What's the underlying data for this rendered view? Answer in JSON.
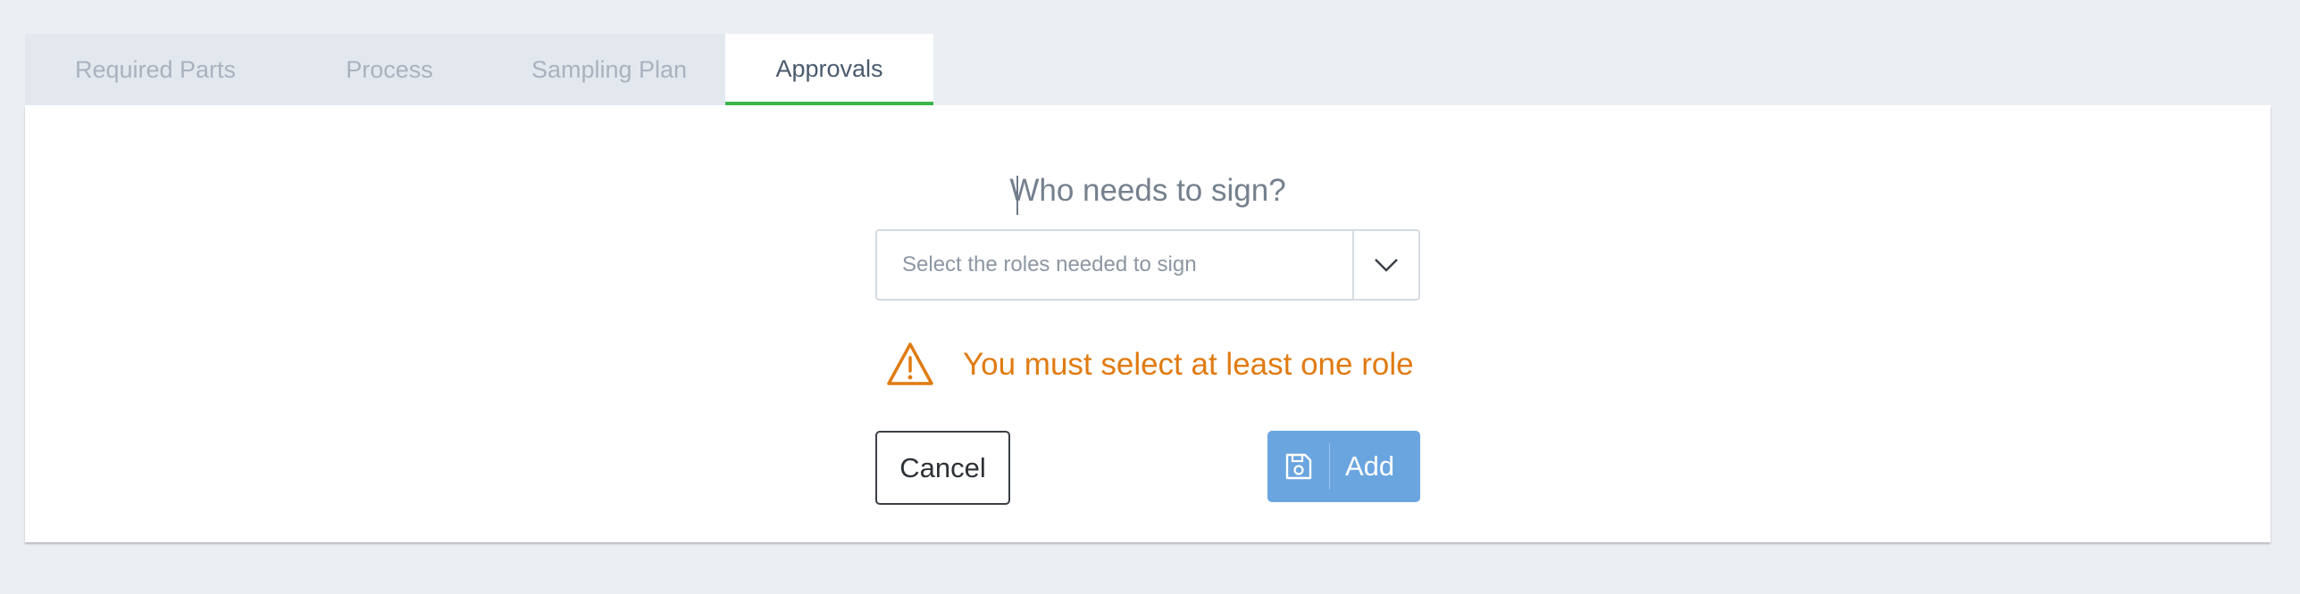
{
  "tabs": [
    {
      "label": "Required Parts"
    },
    {
      "label": "Process"
    },
    {
      "label": "Sampling Plan"
    },
    {
      "label": "Approvals",
      "active": true
    }
  ],
  "signers": {
    "question": "Who needs to sign?",
    "select_placeholder": "Select the roles needed to sign",
    "dropdown_icon": "chevron-down-icon"
  },
  "validation": {
    "icon": "warning-triangle-icon",
    "message": "You must select at least one role",
    "color": "#e07b12"
  },
  "actions": {
    "cancel_label": "Cancel",
    "add_label": "Add",
    "add_icon": "save-icon",
    "add_color": "#6aa5e0"
  },
  "colors": {
    "active_tab_underline": "#3db44a",
    "background": "#ebeef3"
  }
}
